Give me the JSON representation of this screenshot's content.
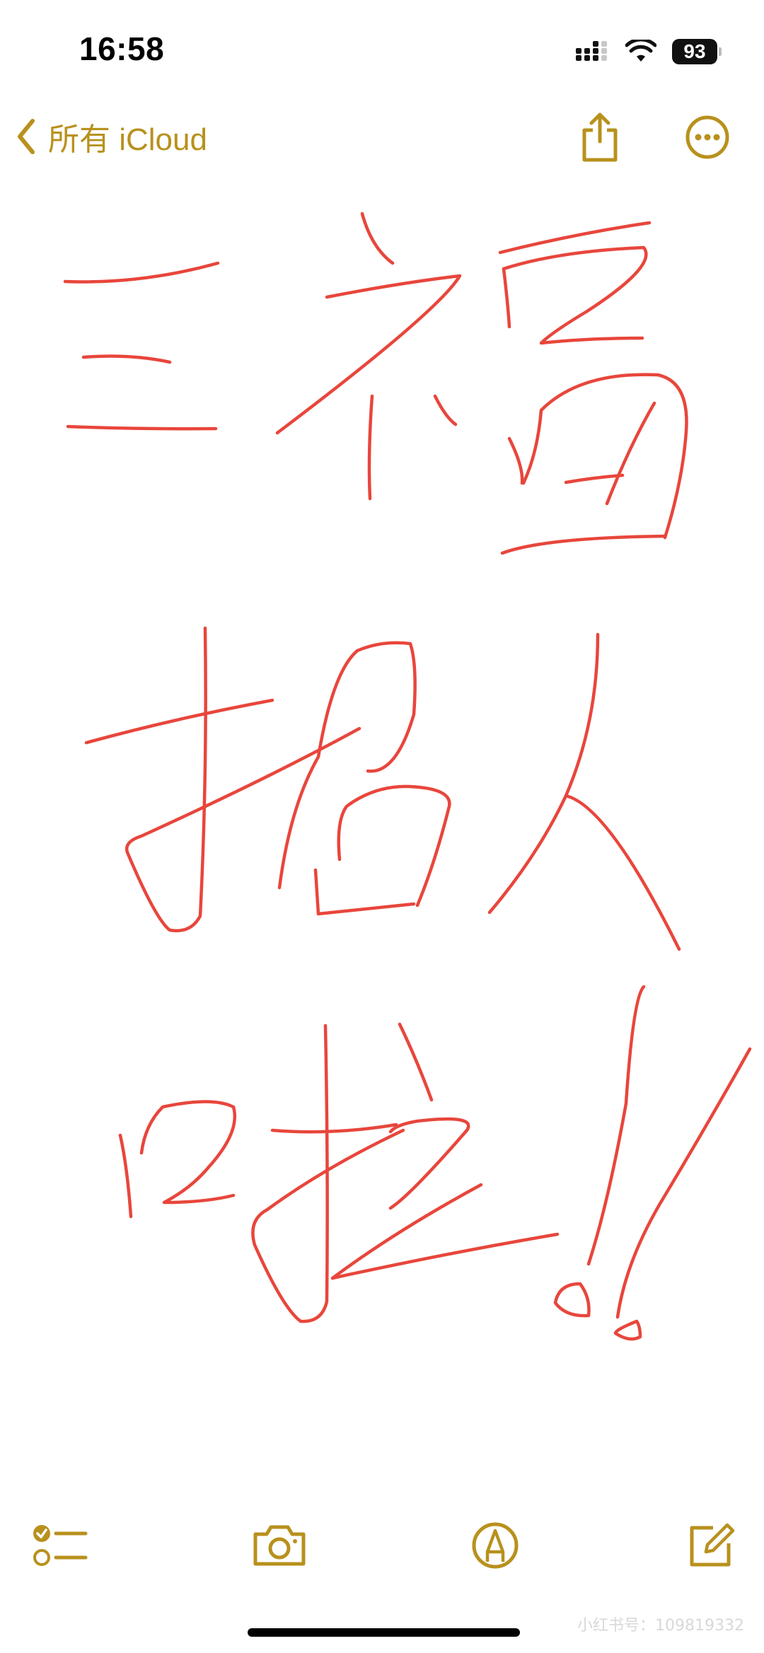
{
  "status_bar": {
    "time": "16:58",
    "battery_level": "93",
    "icons": [
      "cellular-signal-icon",
      "wifi-icon",
      "battery-icon"
    ]
  },
  "nav": {
    "back_label": "所有 iCloud",
    "back_icon": "chevron-left-icon",
    "share_icon": "share-icon",
    "more_icon": "ellipsis-circle-icon"
  },
  "toolbar": {
    "items": [
      "checklist-icon",
      "camera-icon",
      "markup-pen-icon",
      "compose-icon"
    ]
  },
  "watermark": "小红书号：109819332",
  "colors": {
    "accent": "#b8911d",
    "ink": "#e8463c",
    "background": "#ffffff"
  }
}
